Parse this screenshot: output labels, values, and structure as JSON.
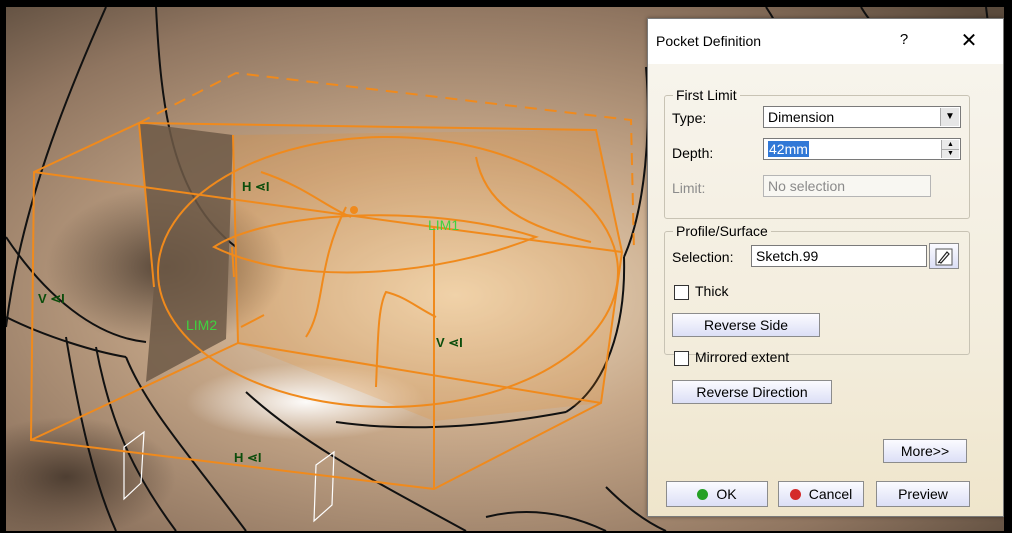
{
  "viewport": {
    "labels": {
      "h_top": "H ⋖I",
      "v_left": "V ⋖I",
      "v_right": "V ⋖I",
      "h_bottom": "H ⋖I",
      "lim1": "LIM1",
      "lim2": "LIM2"
    }
  },
  "dialog": {
    "title": "Pocket Definition",
    "help": "?",
    "close": "✕",
    "first_limit": {
      "legend": "First Limit",
      "type_label": "Type:",
      "type_value": "Dimension",
      "depth_label": "Depth:",
      "depth_value": "42mm",
      "limit_label": "Limit:",
      "limit_value": "No selection"
    },
    "profile": {
      "legend": "Profile/Surface",
      "selection_label": "Selection:",
      "selection_value": "Sketch.99",
      "thick_label": "Thick",
      "thick_checked": false,
      "reverse_side": "Reverse Side"
    },
    "mirrored_label": "Mirrored extent",
    "mirrored_checked": false,
    "reverse_direction": "Reverse Direction",
    "more": "More>>",
    "ok": "OK",
    "cancel": "Cancel",
    "preview": "Preview"
  },
  "colors": {
    "profile": "#f08a1c",
    "label_green": "#0b4d0b",
    "limit_green": "#3ed33e",
    "ok_dot": "#25a025",
    "cancel_dot": "#d42b2b"
  }
}
